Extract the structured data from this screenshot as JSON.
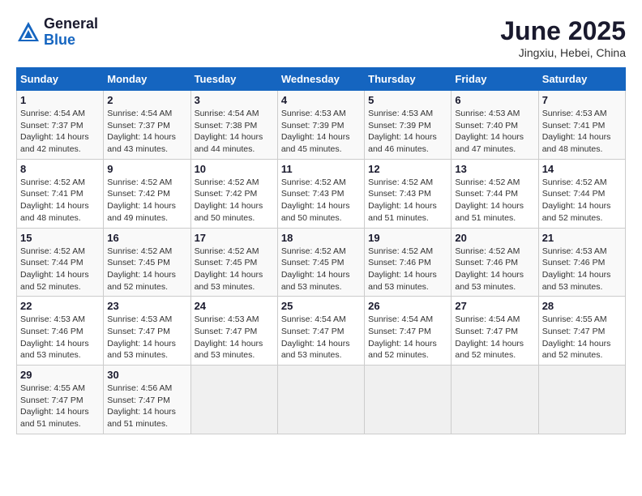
{
  "logo": {
    "general": "General",
    "blue": "Blue"
  },
  "title": "June 2025",
  "subtitle": "Jingxiu, Hebei, China",
  "weekdays": [
    "Sunday",
    "Monday",
    "Tuesday",
    "Wednesday",
    "Thursday",
    "Friday",
    "Saturday"
  ],
  "weeks": [
    [
      {
        "day": "1",
        "sunrise": "4:54 AM",
        "sunset": "7:37 PM",
        "daylight": "14 hours and 42 minutes."
      },
      {
        "day": "2",
        "sunrise": "4:54 AM",
        "sunset": "7:37 PM",
        "daylight": "14 hours and 43 minutes."
      },
      {
        "day": "3",
        "sunrise": "4:54 AM",
        "sunset": "7:38 PM",
        "daylight": "14 hours and 44 minutes."
      },
      {
        "day": "4",
        "sunrise": "4:53 AM",
        "sunset": "7:39 PM",
        "daylight": "14 hours and 45 minutes."
      },
      {
        "day": "5",
        "sunrise": "4:53 AM",
        "sunset": "7:39 PM",
        "daylight": "14 hours and 46 minutes."
      },
      {
        "day": "6",
        "sunrise": "4:53 AM",
        "sunset": "7:40 PM",
        "daylight": "14 hours and 47 minutes."
      },
      {
        "day": "7",
        "sunrise": "4:53 AM",
        "sunset": "7:41 PM",
        "daylight": "14 hours and 48 minutes."
      }
    ],
    [
      {
        "day": "8",
        "sunrise": "4:52 AM",
        "sunset": "7:41 PM",
        "daylight": "14 hours and 48 minutes."
      },
      {
        "day": "9",
        "sunrise": "4:52 AM",
        "sunset": "7:42 PM",
        "daylight": "14 hours and 49 minutes."
      },
      {
        "day": "10",
        "sunrise": "4:52 AM",
        "sunset": "7:42 PM",
        "daylight": "14 hours and 50 minutes."
      },
      {
        "day": "11",
        "sunrise": "4:52 AM",
        "sunset": "7:43 PM",
        "daylight": "14 hours and 50 minutes."
      },
      {
        "day": "12",
        "sunrise": "4:52 AM",
        "sunset": "7:43 PM",
        "daylight": "14 hours and 51 minutes."
      },
      {
        "day": "13",
        "sunrise": "4:52 AM",
        "sunset": "7:44 PM",
        "daylight": "14 hours and 51 minutes."
      },
      {
        "day": "14",
        "sunrise": "4:52 AM",
        "sunset": "7:44 PM",
        "daylight": "14 hours and 52 minutes."
      }
    ],
    [
      {
        "day": "15",
        "sunrise": "4:52 AM",
        "sunset": "7:44 PM",
        "daylight": "14 hours and 52 minutes."
      },
      {
        "day": "16",
        "sunrise": "4:52 AM",
        "sunset": "7:45 PM",
        "daylight": "14 hours and 52 minutes."
      },
      {
        "day": "17",
        "sunrise": "4:52 AM",
        "sunset": "7:45 PM",
        "daylight": "14 hours and 53 minutes."
      },
      {
        "day": "18",
        "sunrise": "4:52 AM",
        "sunset": "7:45 PM",
        "daylight": "14 hours and 53 minutes."
      },
      {
        "day": "19",
        "sunrise": "4:52 AM",
        "sunset": "7:46 PM",
        "daylight": "14 hours and 53 minutes."
      },
      {
        "day": "20",
        "sunrise": "4:52 AM",
        "sunset": "7:46 PM",
        "daylight": "14 hours and 53 minutes."
      },
      {
        "day": "21",
        "sunrise": "4:53 AM",
        "sunset": "7:46 PM",
        "daylight": "14 hours and 53 minutes."
      }
    ],
    [
      {
        "day": "22",
        "sunrise": "4:53 AM",
        "sunset": "7:46 PM",
        "daylight": "14 hours and 53 minutes."
      },
      {
        "day": "23",
        "sunrise": "4:53 AM",
        "sunset": "7:47 PM",
        "daylight": "14 hours and 53 minutes."
      },
      {
        "day": "24",
        "sunrise": "4:53 AM",
        "sunset": "7:47 PM",
        "daylight": "14 hours and 53 minutes."
      },
      {
        "day": "25",
        "sunrise": "4:54 AM",
        "sunset": "7:47 PM",
        "daylight": "14 hours and 53 minutes."
      },
      {
        "day": "26",
        "sunrise": "4:54 AM",
        "sunset": "7:47 PM",
        "daylight": "14 hours and 52 minutes."
      },
      {
        "day": "27",
        "sunrise": "4:54 AM",
        "sunset": "7:47 PM",
        "daylight": "14 hours and 52 minutes."
      },
      {
        "day": "28",
        "sunrise": "4:55 AM",
        "sunset": "7:47 PM",
        "daylight": "14 hours and 52 minutes."
      }
    ],
    [
      {
        "day": "29",
        "sunrise": "4:55 AM",
        "sunset": "7:47 PM",
        "daylight": "14 hours and 51 minutes."
      },
      {
        "day": "30",
        "sunrise": "4:56 AM",
        "sunset": "7:47 PM",
        "daylight": "14 hours and 51 minutes."
      },
      null,
      null,
      null,
      null,
      null
    ]
  ]
}
